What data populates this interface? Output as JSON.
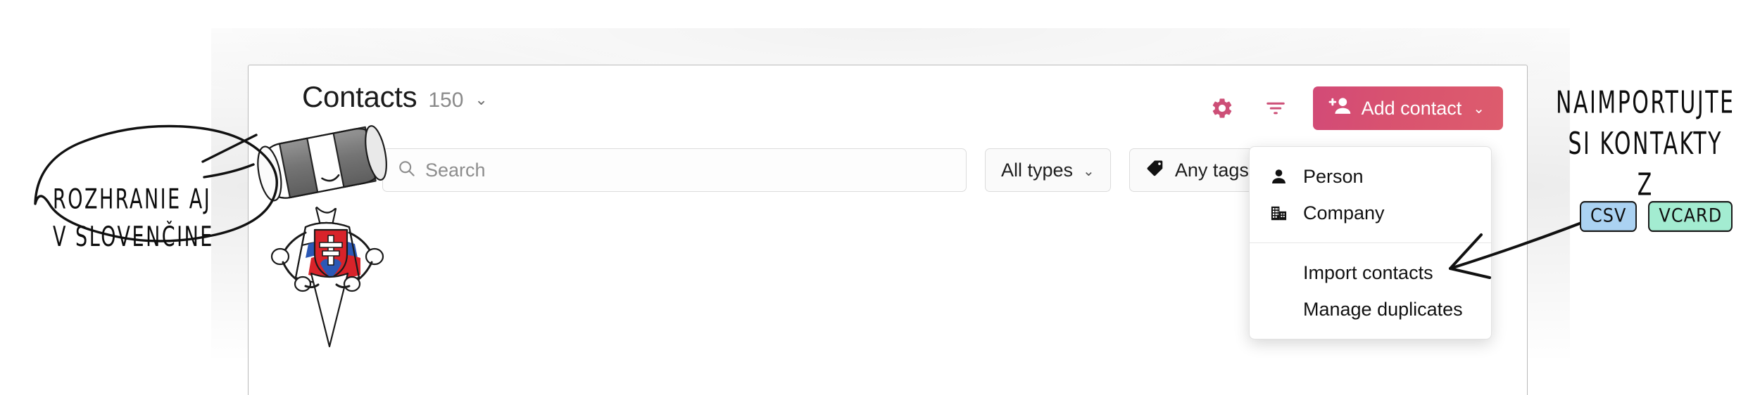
{
  "header": {
    "title": "Contacts",
    "count": "150",
    "caret": "⌄",
    "settings_icon": "gear-icon",
    "filter_icon": "filter-icon",
    "add_contact_label": "Add contact",
    "add_contact_caret": "⌄"
  },
  "filters": {
    "search_placeholder": "Search",
    "search_value": "",
    "search_icon": "search-icon",
    "type_filter_label": "All types",
    "type_filter_caret": "⌄",
    "tags_filter_label": "Any tags",
    "tags_filter_icon": "tag-icon",
    "tags_filter_caret": "⌄"
  },
  "dropdown": {
    "items": [
      {
        "label": "Person",
        "icon": "person-icon"
      },
      {
        "label": "Company",
        "icon": "building-icon"
      },
      {
        "label": "Import contacts",
        "icon": ""
      },
      {
        "label": "Manage duplicates",
        "icon": ""
      }
    ]
  },
  "annotations": {
    "speech_bubble": {
      "line1": "ROZHRANIE AJ",
      "line2": "V SLOVENČINE"
    },
    "right_note": {
      "line1": "NAIMPORTUJTE",
      "line2": "SI KONTAKTY",
      "line3": "Z"
    },
    "chips": [
      {
        "label": "CSV",
        "color": "#abd2f2"
      },
      {
        "label": "VCARD",
        "color": "#a3ecd1"
      }
    ]
  },
  "colors": {
    "accent_pink": "#d9536f",
    "accent_pink_dark": "#d24a77",
    "menu_text": "#111111",
    "muted_text": "#8a8a8a",
    "chip_csv": "#abd2f2",
    "chip_vcard": "#a3ecd1",
    "flag_blue": "#2b58b5",
    "flag_red": "#d8232a"
  }
}
